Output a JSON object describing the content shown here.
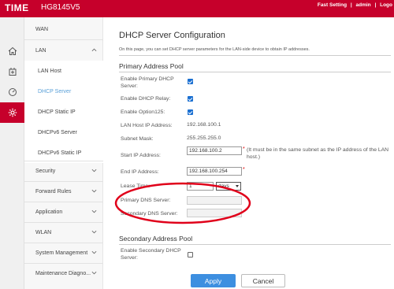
{
  "header": {
    "brand": "TIME",
    "model": "HG8145V5",
    "links": [
      "Fast Setting",
      "|",
      "admin",
      "|",
      "Logo"
    ]
  },
  "rail_icons": [
    "home-icon",
    "add-box-icon",
    "speedometer-icon",
    "gear-icon"
  ],
  "sidebar": {
    "items": [
      {
        "label": "WAN",
        "type": "top"
      },
      {
        "label": "LAN",
        "type": "top",
        "expanded": true
      },
      {
        "label": "LAN Host",
        "type": "sub"
      },
      {
        "label": "DHCP Server",
        "type": "sub",
        "selected": true
      },
      {
        "label": "DHCP Static IP",
        "type": "sub"
      },
      {
        "label": "DHCPv6 Server",
        "type": "sub"
      },
      {
        "label": "DHCPv6 Static IP",
        "type": "sub"
      },
      {
        "label": "Security",
        "type": "top"
      },
      {
        "label": "Forward Rules",
        "type": "top"
      },
      {
        "label": "Application",
        "type": "top"
      },
      {
        "label": "WLAN",
        "type": "top"
      },
      {
        "label": "System Management",
        "type": "top"
      },
      {
        "label": "Maintenance Diagno...",
        "type": "top"
      }
    ]
  },
  "main": {
    "title": "DHCP Server Configuration",
    "description": "On this page, you can set DHCP server parameters for the LAN-side device to obtain IP addresses.",
    "primary_pool": {
      "title": "Primary Address Pool",
      "enable_primary_label": "Enable Primary DHCP Server:",
      "enable_primary_checked": true,
      "enable_relay_label": "Enable DHCP Relay:",
      "enable_relay_checked": true,
      "enable_option125_label": "Enable Option125:",
      "enable_option125_checked": true,
      "lan_host_ip_label": "LAN Host IP Address:",
      "lan_host_ip_value": "192.168.100.1",
      "subnet_mask_label": "Subnet Mask:",
      "subnet_mask_value": "255.255.255.0",
      "start_ip_label": "Start IP Address:",
      "start_ip_value": "192.168.100.2",
      "required_mark": "*",
      "start_ip_hint": "(It must be in the same subnet as the IP address of the LAN host.)",
      "end_ip_label": "End IP Address:",
      "end_ip_value": "192.168.100.254",
      "lease_time_label": "Lease Time:",
      "lease_time_value": "1",
      "lease_unit": "days",
      "primary_dns_label": "Primary DNS Server:",
      "primary_dns_value": "",
      "secondary_dns_label": "Secondary DNS Server:",
      "secondary_dns_value": ""
    },
    "secondary_pool": {
      "title": "Secondary Address Pool",
      "enable_secondary_label": "Enable Secondary DHCP Server:",
      "enable_secondary_checked": false
    },
    "buttons": {
      "apply": "Apply",
      "cancel": "Cancel"
    }
  },
  "colors": {
    "header_red": "#c6002b",
    "annotation_red": "#e0001a",
    "apply_blue": "#3d8fe0",
    "selected_link": "#5aa0d8"
  }
}
